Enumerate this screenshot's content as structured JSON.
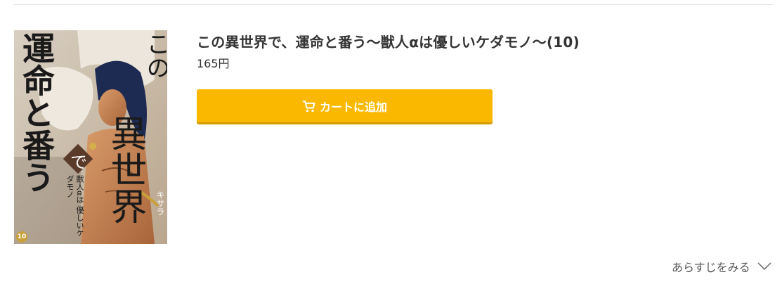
{
  "product": {
    "title": "この異世界で、運命と番う～獣人αは優しいケダモノ～(10)",
    "price": "165円"
  },
  "cart_button": {
    "label": "カートに追加",
    "icon": "cart-icon",
    "color": "#fab900"
  },
  "synopsis": {
    "label": "あらすじをみる",
    "icon": "chevron-down-icon"
  },
  "cover": {
    "title_vertical_left": "運命と番う",
    "title_vertical_top": "この",
    "title_vertical_main": "異世界",
    "title_particle": "で",
    "subtitle_col1": "獣人αは",
    "subtitle_col2": "優しいケダモノ",
    "author": "キサラ",
    "volume": "10"
  }
}
